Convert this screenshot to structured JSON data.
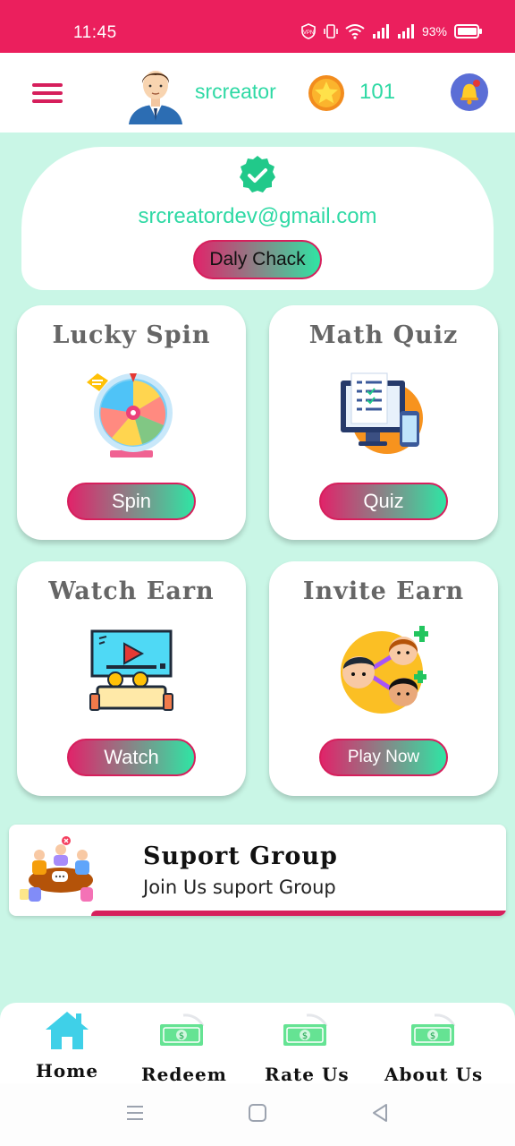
{
  "status_bar": {
    "time": "11:45",
    "battery": "93%",
    "icons": [
      "vpn-icon",
      "vibrate-icon",
      "wifi-icon",
      "signal-icon",
      "signal-icon",
      "battery-icon"
    ]
  },
  "header": {
    "menu_icon": "menu-icon",
    "username": "srcreator",
    "coin_count": "101",
    "bell_icon": "bell-icon"
  },
  "profile": {
    "email": "srcreatordev@gmail.com",
    "daily_button": "Daly Chack"
  },
  "cards": [
    {
      "title": "Lucky Spin",
      "button": "Spin",
      "illustration": "spin-wheel-icon"
    },
    {
      "title": "Math Quiz",
      "button": "Quiz",
      "illustration": "quiz-computer-icon"
    },
    {
      "title": "Watch Earn",
      "button": "Watch",
      "illustration": "cinema-icon"
    },
    {
      "title": "Invite Earn",
      "button": "Play Now",
      "illustration": "invite-friends-icon"
    }
  ],
  "support": {
    "title": "Suport Group",
    "subtitle": "Join Us suport Group"
  },
  "bottom_nav": [
    {
      "label": "Home",
      "icon": "home-icon"
    },
    {
      "label": "Redeem",
      "icon": "money-icon"
    },
    {
      "label": "Rate Us",
      "icon": "money-icon"
    },
    {
      "label": "About Us",
      "icon": "money-icon"
    }
  ],
  "colors": {
    "status_bar": "#eb1f5d",
    "accent": "#2ed9a4",
    "background": "#c9f6e6",
    "pink": "#d61f5c"
  }
}
